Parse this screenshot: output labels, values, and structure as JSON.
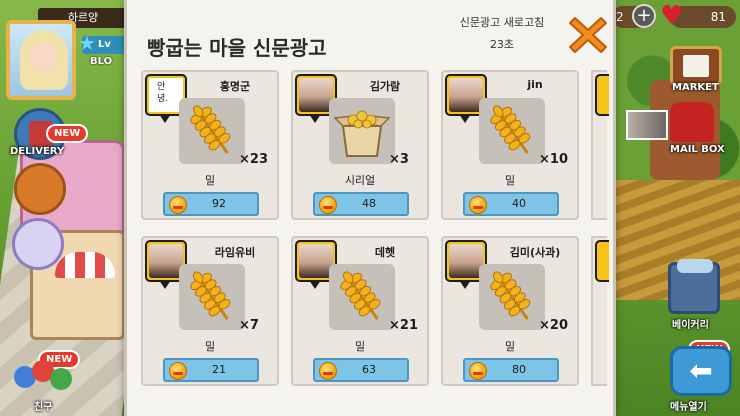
{
  "hud": {
    "profile_name": "하르양",
    "level_prefix": "Lv",
    "profile_sub": "BLO",
    "coins_partial": "2",
    "hearts": "81"
  },
  "left_menu": {
    "delivery_new": "NEW",
    "delivery_label": "DELIVERY",
    "friends_new": "NEW",
    "friends_label": "친구"
  },
  "right_menu": {
    "market_label": "MARKET",
    "mailbox_label": "MAIL BOX",
    "bakery_label": "베이커리",
    "menu_new": "NEW",
    "menu_label": "메뉴열기"
  },
  "panel": {
    "title": "빵굽는 마을 신문광고",
    "refresh_label": "신문광고 새로고침",
    "refresh_timer": "23초"
  },
  "ads": [
    {
      "user": "홍명군",
      "avatar": "note",
      "note_text": "안\n녕.",
      "item": "밀",
      "item_icon": "wheat-icon",
      "qty": "×23",
      "price": "92"
    },
    {
      "user": "김가람",
      "avatar": "photo",
      "item": "시리얼",
      "item_icon": "cereal-box-icon",
      "qty": "×3",
      "price": "48"
    },
    {
      "user": "jin",
      "avatar": "photo",
      "item": "밀",
      "item_icon": "wheat-icon",
      "qty": "×10",
      "price": "40"
    },
    {
      "user": "라임유비",
      "avatar": "photo",
      "item": "밀",
      "item_icon": "wheat-icon",
      "qty": "×7",
      "price": "21"
    },
    {
      "user": "데헷",
      "avatar": "photo",
      "item": "밀",
      "item_icon": "wheat-icon",
      "qty": "×21",
      "price": "63"
    },
    {
      "user": "김미(사과)",
      "avatar": "photo",
      "item": "밀",
      "item_icon": "wheat-icon",
      "qty": "×20",
      "price": "80"
    }
  ],
  "colors": {
    "price_button": "#7ec4e6",
    "avatar_frame": "#f6c319",
    "close_button": "#f28a1c"
  }
}
